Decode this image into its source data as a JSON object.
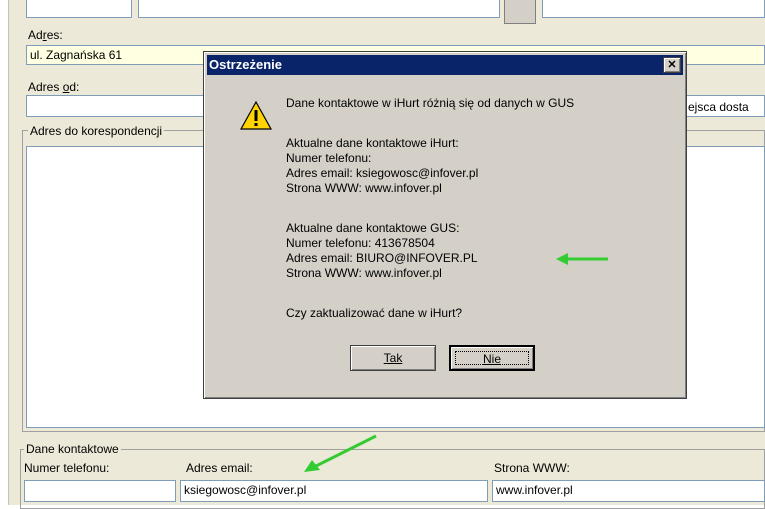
{
  "form": {
    "address_label": "Adres:",
    "address_value": "ul. Zagnańska 61",
    "address_from_label": "Adres od:",
    "correspondence_label": "Adres do korespondencji",
    "delivery_place_label_partial": "ejsca dosta",
    "contact_group_title": "Dane kontaktowe",
    "phone_label": "Numer telefonu:",
    "phone_value": "",
    "email_label": "Adres email:",
    "email_value": "ksiegowosc@infover.pl",
    "www_label": "Strona WWW:",
    "www_value": "www.infover.pl"
  },
  "dialog": {
    "title": "Ostrzeżenie",
    "close_symbol": "✕",
    "lines": [
      "Dane kontaktowe w iHurt różnią się od danych w GUS",
      "Aktualne dane kontaktowe iHurt:",
      "Numer telefonu:",
      "Adres email: ksiegowosc@infover.pl",
      "Strona WWW: www.infover.pl",
      "Aktualne dane kontaktowe GUS:",
      "Numer telefonu: 413678504",
      "Adres email: BIURO@INFOVER.PL",
      "Strona WWW:  www.infover.pl",
      "Czy zaktualizować dane w iHurt?"
    ],
    "yes_label": "Tak",
    "no_label": "Nie",
    "icon": "warning-icon"
  },
  "colors": {
    "titlebar": "#0a246a",
    "arrow": "#33cc33",
    "yellow_field": "#ffffe1"
  }
}
